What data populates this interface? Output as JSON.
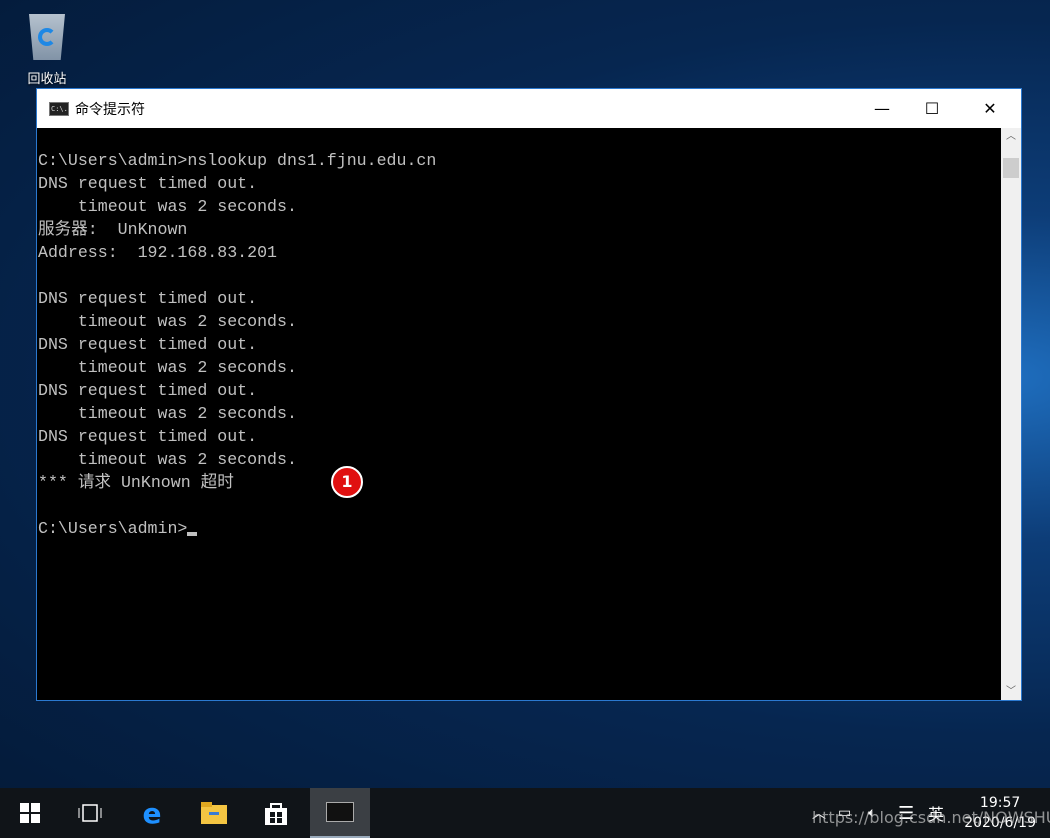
{
  "desktop": {
    "recycle_bin_label": "回收站"
  },
  "window": {
    "title": "命令提示符",
    "icon_text": "C:\\.",
    "minimize": "—",
    "maximize": "☐",
    "close": "✕"
  },
  "console": {
    "lines": [
      "C:\\Users\\admin>nslookup dns1.fjnu.edu.cn",
      "DNS request timed out.",
      "    timeout was 2 seconds.",
      "服务器:  UnKnown",
      "Address:  192.168.83.201",
      "",
      "DNS request timed out.",
      "    timeout was 2 seconds.",
      "DNS request timed out.",
      "    timeout was 2 seconds.",
      "DNS request timed out.",
      "    timeout was 2 seconds.",
      "DNS request timed out.",
      "    timeout was 2 seconds.",
      "*** 请求 UnKnown 超时",
      "",
      "C:\\Users\\admin>"
    ]
  },
  "annotation": {
    "marker": "1",
    "color": "#e01010"
  },
  "taskbar": {
    "ime": "英",
    "time": "19:57",
    "date": "2020/6/19"
  },
  "watermark": "https://blog.csdn.net/NOWSHUT"
}
